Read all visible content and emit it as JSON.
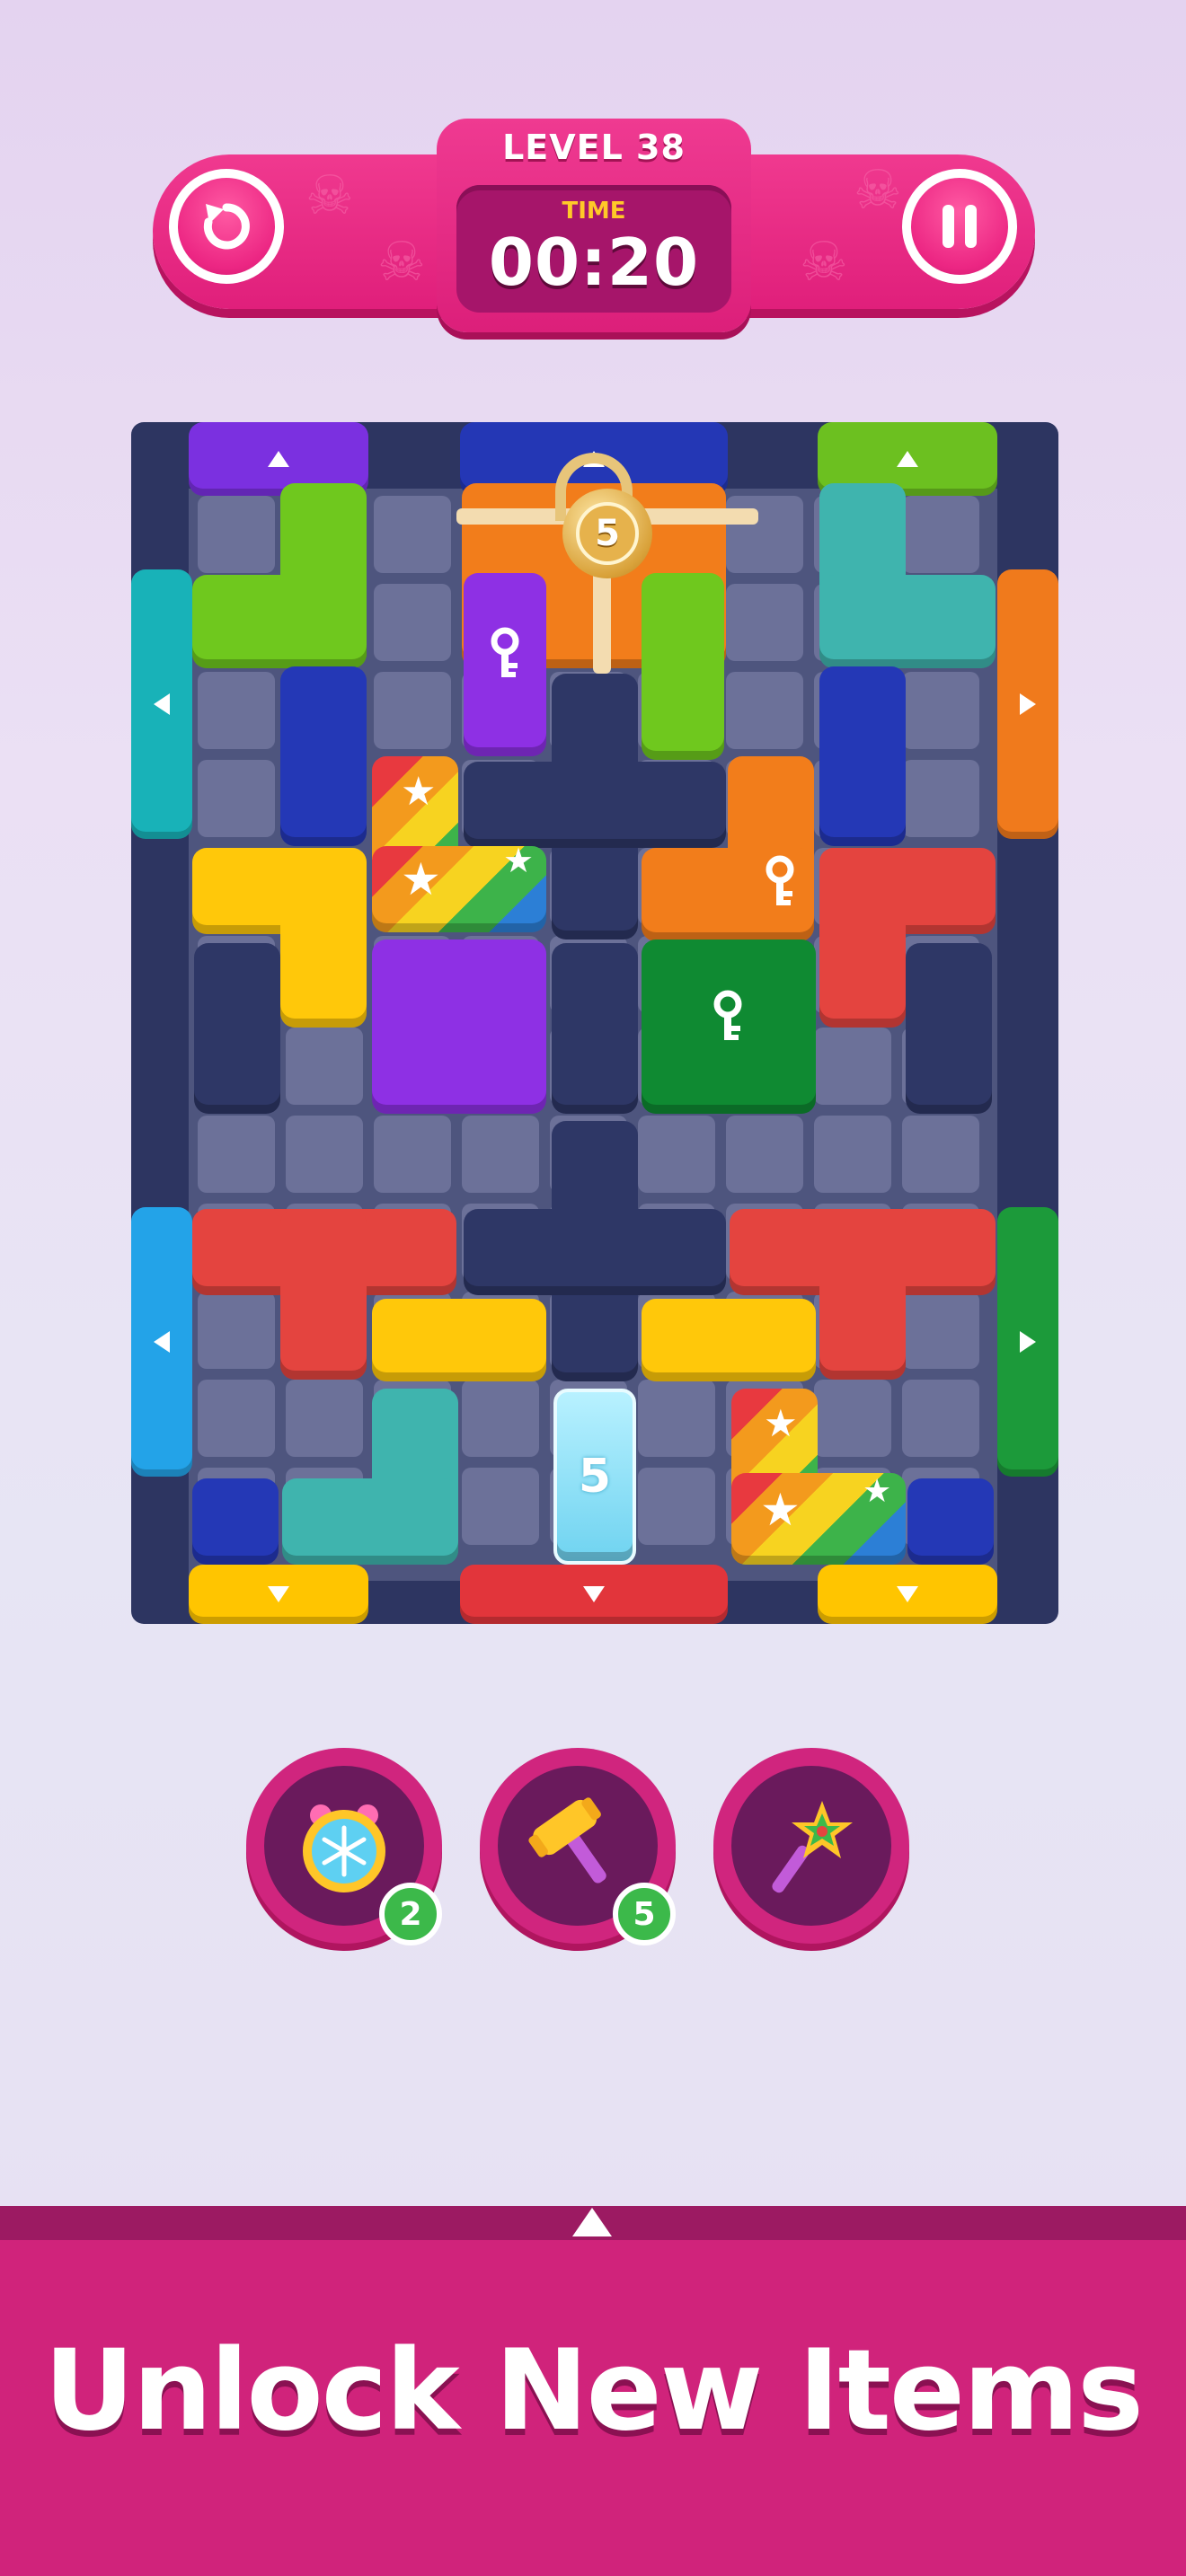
{
  "header": {
    "level_label": "LEVEL 38",
    "time_label": "TIME",
    "time_value": "00:20"
  },
  "board": {
    "lock_counter": "5",
    "ice_counter": "5"
  },
  "powerups": [
    {
      "name": "freeze-clock",
      "count": "2"
    },
    {
      "name": "hammer",
      "count": "5"
    },
    {
      "name": "magic-wand",
      "count": ""
    }
  ],
  "banner": {
    "text": "Unlock New Items"
  },
  "colors": {
    "accent": "#e01f7b",
    "board": "#2d3561",
    "cell": "#6c7199"
  }
}
